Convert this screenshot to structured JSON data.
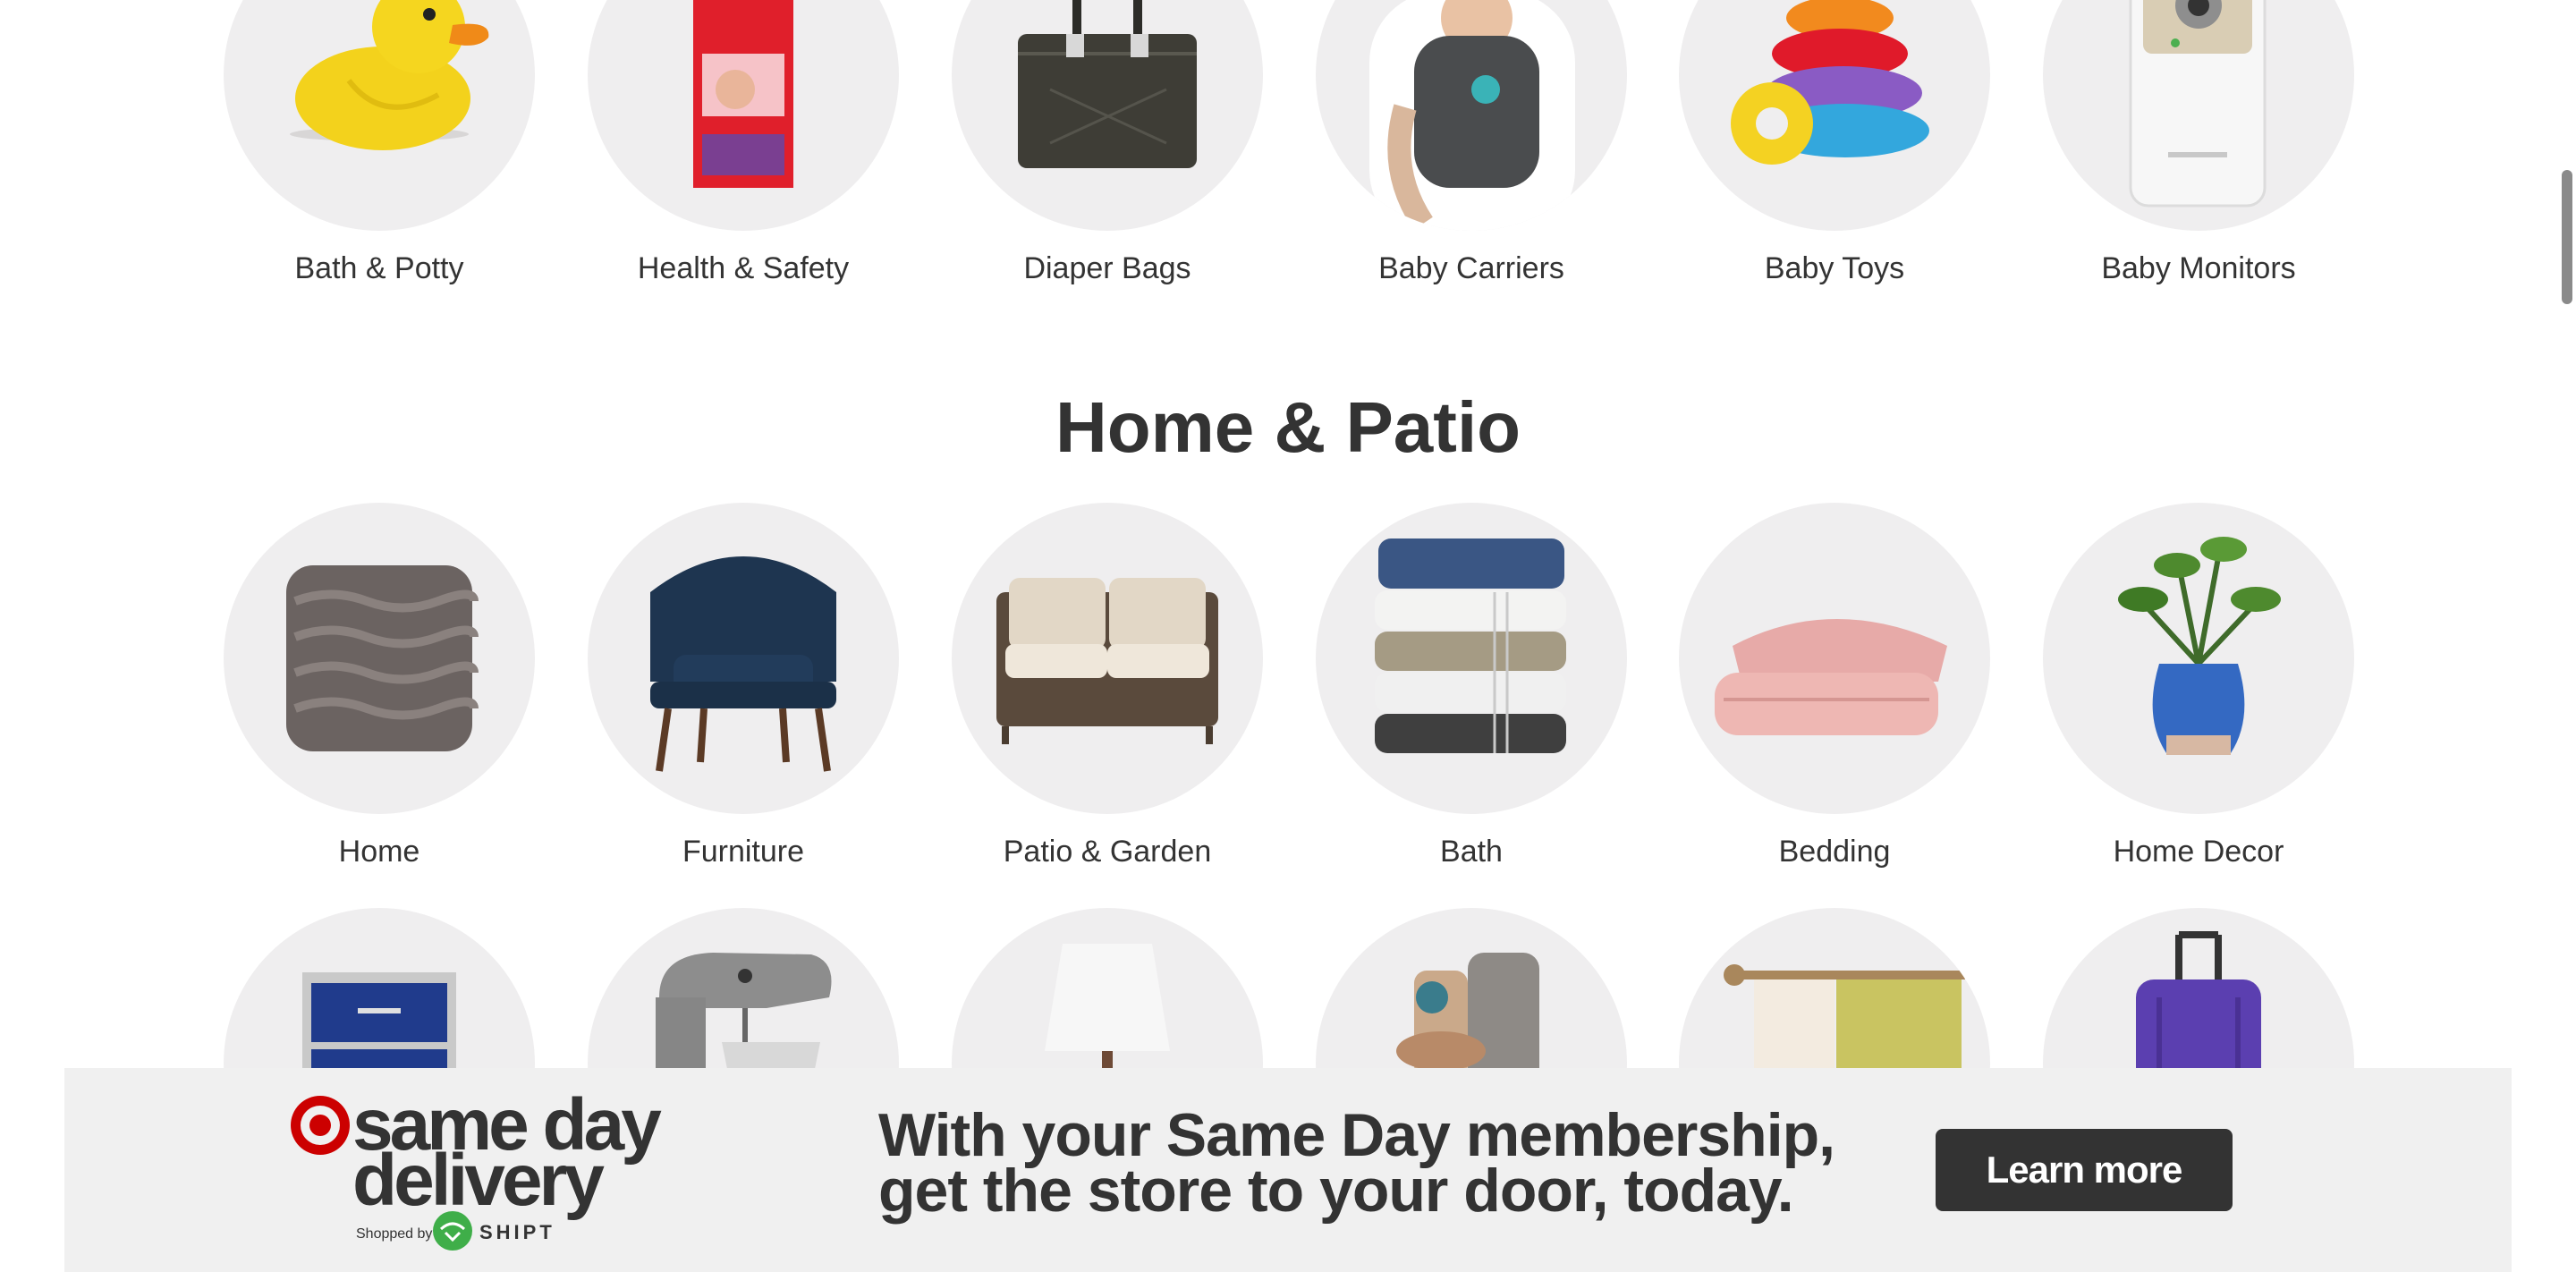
{
  "baby_row": [
    {
      "label": "Bath & Potty",
      "icon": "rubber-duck-image"
    },
    {
      "label": "Health & Safety",
      "icon": "medicine-box-image"
    },
    {
      "label": "Diaper Bags",
      "icon": "diaper-bag-image"
    },
    {
      "label": "Baby Carriers",
      "icon": "baby-carrier-image"
    },
    {
      "label": "Baby Toys",
      "icon": "stacking-toy-image"
    },
    {
      "label": "Baby Monitors",
      "icon": "baby-monitor-image"
    }
  ],
  "section": {
    "title": "Home & Patio"
  },
  "home_row": [
    {
      "label": "Home",
      "icon": "pillow-image"
    },
    {
      "label": "Furniture",
      "icon": "armchair-image"
    },
    {
      "label": "Patio & Garden",
      "icon": "patio-loveseat-image"
    },
    {
      "label": "Bath",
      "icon": "towel-stack-image"
    },
    {
      "label": "Bedding",
      "icon": "duvet-image"
    },
    {
      "label": "Home Decor",
      "icon": "potted-plant-image"
    }
  ],
  "third_row": [
    {
      "icon": "storage-drawers-image"
    },
    {
      "icon": "stand-mixer-image"
    },
    {
      "icon": "table-lamp-image"
    },
    {
      "icon": "kitchenware-image"
    },
    {
      "icon": "curtains-image"
    },
    {
      "icon": "luggage-image"
    }
  ],
  "banner": {
    "logo_line1": "same day",
    "logo_line2": "delivery",
    "shopped_by": "Shopped by",
    "shipt": "SHIPT",
    "message_line1": "With your Same Day membership,",
    "message_line2": "get the store to your door, today.",
    "button": "Learn more"
  },
  "colors": {
    "brand_red": "#cc0000",
    "button_bg": "#333333",
    "circle_bg": "#efeeef",
    "banner_bg": "#f0f0f0",
    "shipt_green": "#3fae49"
  }
}
